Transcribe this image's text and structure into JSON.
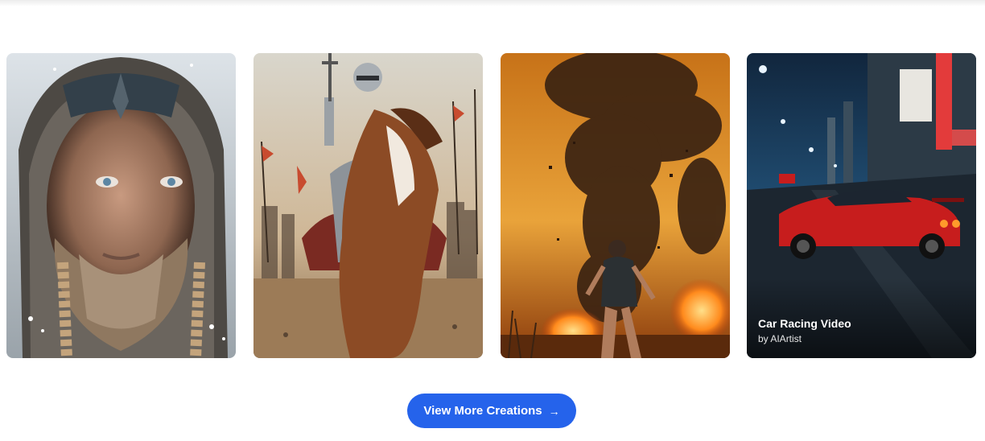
{
  "gallery": {
    "cards": [
      {
        "subject": "viking-portrait"
      },
      {
        "subject": "armored-knight-on-horse"
      },
      {
        "subject": "woman-fleeing-explosion"
      },
      {
        "subject": "red-sports-car-neon-city",
        "title": "Car Racing Video",
        "author": "by AIArtist"
      }
    ]
  },
  "cta": {
    "label": "View More Creations",
    "icon": "arrow-right-icon",
    "color": "#2563eb"
  }
}
